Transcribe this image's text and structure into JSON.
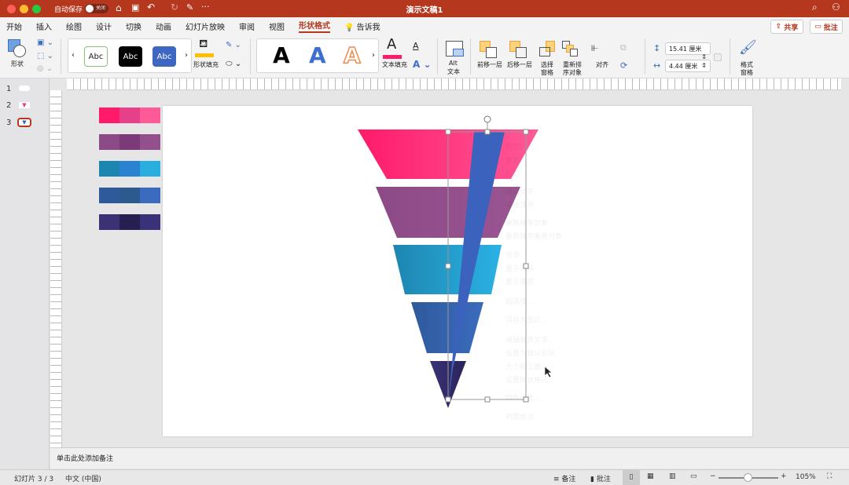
{
  "titlebar": {
    "title": "演示文稿1",
    "autosave": "自动保存",
    "toggle": "关闭"
  },
  "tabs": [
    "开始",
    "插入",
    "绘图",
    "设计",
    "切换",
    "动画",
    "幻灯片放映",
    "审阅",
    "视图",
    "形状格式"
  ],
  "tell_me": "告诉我",
  "share": "共享",
  "comment": "批注",
  "ribbon": {
    "shapes": "形状",
    "style_sample": "Abc",
    "shape_fill": "形状填充",
    "wordart": "A",
    "text_fill": "文本填充",
    "alt_text_1": "Alt",
    "alt_text_2": "文本",
    "forward": "前移一层",
    "backward": "后移一层",
    "select_pane_1": "选择",
    "select_pane_2": "窗格",
    "reorder_1": "重新排",
    "reorder_2": "序对象",
    "align": "对齐",
    "height": "15.41 厘米",
    "width": "4.44 厘米",
    "format_pane_1": "格式",
    "format_pane_2": "窗格"
  },
  "thumbnails": [
    "1",
    "2",
    "3"
  ],
  "context_menu": [
    "剪切",
    "复制",
    "粘贴",
    "编辑文字",
    "编辑顶点",
    "重新排序对象",
    "重新排序重叠对象",
    "组合",
    "置于顶层",
    "置于底层",
    "超链接...",
    "另存为图片...",
    "编辑替换文字...",
    "设置为默认形状",
    "大小和位置...",
    "设置形状格式...",
    "动作设置...",
    "新建批注"
  ],
  "notes_placeholder": "单击此处添加备注",
  "status": {
    "slide": "幻灯片 3 / 3",
    "lang": "中文 (中国)",
    "notes": "备注",
    "comments": "批注",
    "zoom": "105%"
  },
  "colors": {
    "accent": "#b5381e",
    "pink": "#ff2d78",
    "purple": "#8a4a86",
    "cyan": "#2aa7d8",
    "blue": "#3a5fa8",
    "navy": "#3a3578",
    "stripe": "#3b62bd"
  },
  "swatches": [
    [
      "#ff1a6a",
      "#e83f8a",
      "#ff5a98"
    ],
    [
      "#8c4a86",
      "#7c3a78",
      "#93508c"
    ],
    [
      "#1d86b0",
      "#2a82d0",
      "#2aaee0"
    ],
    [
      "#2e5a9c",
      "#2c5a8e",
      "#3b6bbe"
    ],
    [
      "#3a3275",
      "#25204f",
      "#3a3278"
    ]
  ]
}
